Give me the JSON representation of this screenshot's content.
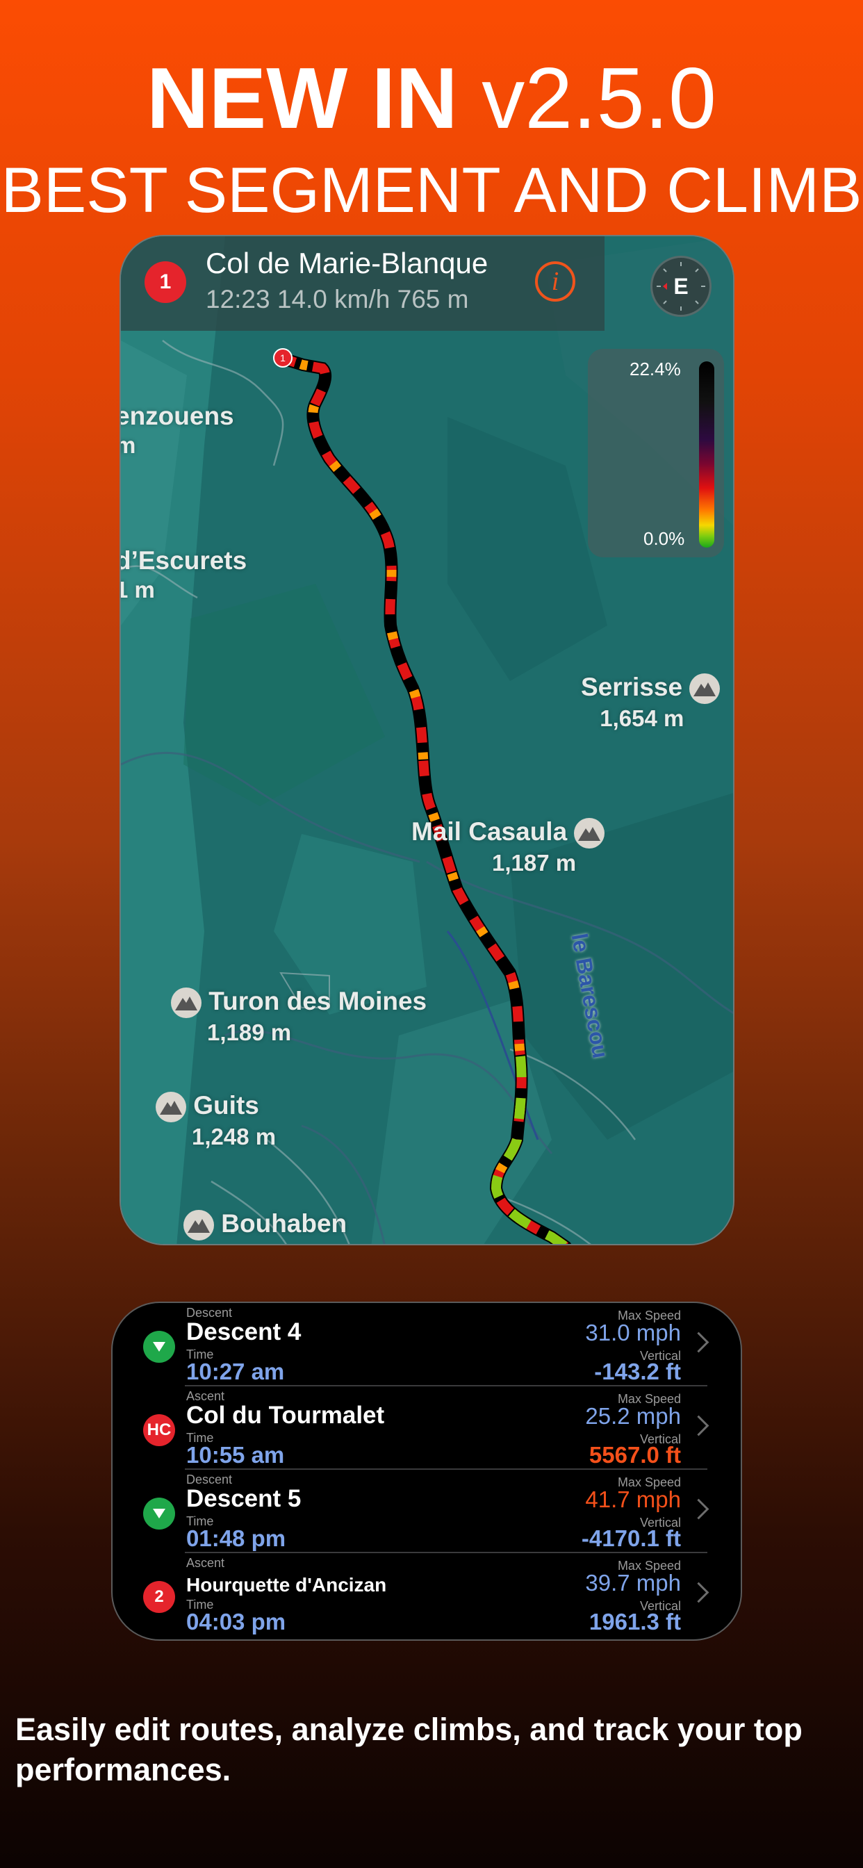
{
  "headline": {
    "bold": "NEW IN",
    "version": "v2.5.0",
    "subtitle": "BEST SEGMENT AND CLIMB"
  },
  "map": {
    "segment": {
      "number": "1",
      "title": "Col de Marie-Blanque",
      "subtitle": "12:23 14.0 km/h 765 m",
      "info_icon": "info-icon"
    },
    "compass": {
      "label": "E",
      "icon": "compass-icon"
    },
    "legend": {
      "max": "22.4%",
      "min": "0.0%"
    },
    "start_marker": "1",
    "labels": [
      {
        "name": "enzouens",
        "elev": "m"
      },
      {
        "name": "d’Escurets",
        "elev": "1 m"
      },
      {
        "name": "Serrisse",
        "elev": "1,654 m"
      },
      {
        "name": "Mail Casaula",
        "elev": "1,187 m"
      },
      {
        "name": "Turon des Moines",
        "elev": "1,189 m"
      },
      {
        "name": "Guits",
        "elev": "1,248 m"
      },
      {
        "name": "Bouhaben",
        "elev": ""
      }
    ],
    "river": "le Barescou"
  },
  "segments": [
    {
      "category": "Descent",
      "name": "Descent 4",
      "time_label": "Time",
      "time": "10:27 am",
      "speed_label": "Max Speed",
      "speed": "31.0 mph",
      "vertical_label": "Vertical",
      "vertical": "-143.2 ft",
      "badge": "",
      "badge_type": "descent"
    },
    {
      "category": "Ascent",
      "name": "Col du Tourmalet",
      "time_label": "Time",
      "time": "10:55 am",
      "speed_label": "Max Speed",
      "speed": "25.2 mph",
      "vertical_label": "Vertical",
      "vertical": "5567.0 ft",
      "badge": "HC",
      "badge_type": "climb"
    },
    {
      "category": "Descent",
      "name": "Descent 5",
      "time_label": "Time",
      "time": "01:48 pm",
      "speed_label": "Max Speed",
      "speed": "41.7 mph",
      "vertical_label": "Vertical",
      "vertical": "-4170.1 ft",
      "badge": "",
      "badge_type": "descent"
    },
    {
      "category": "Ascent",
      "name": "Hourquette d'Ancizan",
      "time_label": "Time",
      "time": "04:03 pm",
      "speed_label": "Max Speed",
      "speed": "39.7 mph",
      "vertical_label": "Vertical",
      "vertical": "1961.3 ft",
      "badge": "2",
      "badge_type": "climb"
    }
  ],
  "caption": "Easily edit routes, analyze climbs, and track your top performances.",
  "colors": {
    "accent_orange": "#f4501a",
    "value_blue": "#7fa4ea",
    "descent_green": "#1fa84a",
    "climb_red": "#e5242c"
  }
}
